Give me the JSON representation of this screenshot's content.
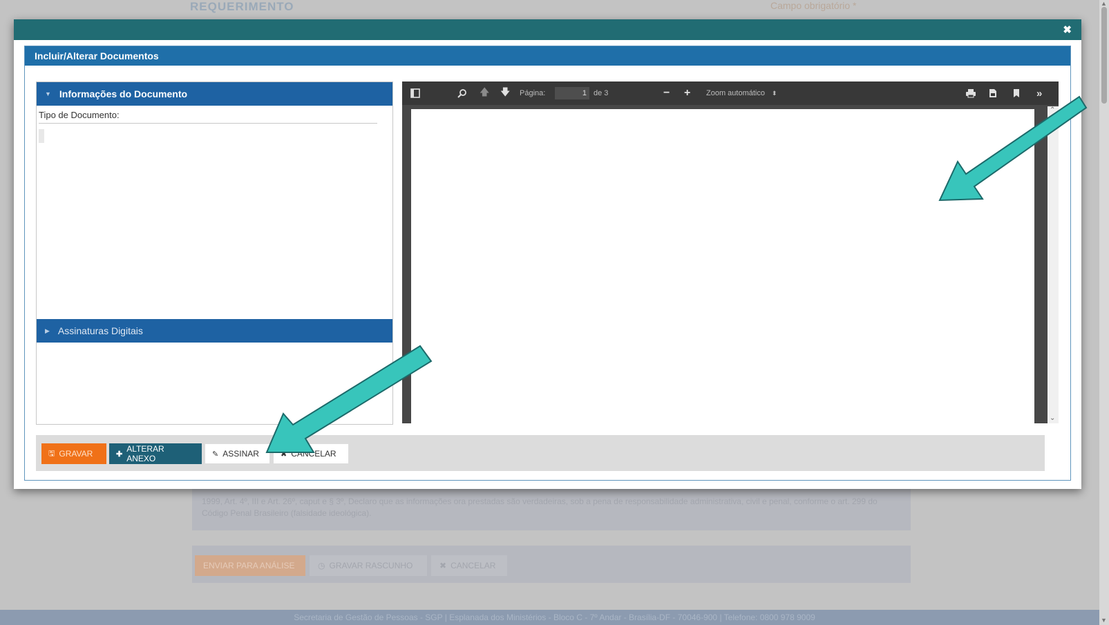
{
  "background": {
    "title": "REQUERIMENTO",
    "top_right": "Campo obrigatório *",
    "declaration_text": "1999, Art. 4º, III e Art. 26º, caput e § 3º, Declaro que as informações ora prestadas são verdadeiras, sob a pena de responsabilidade administrativa, civil e penal, conforme o art. 299 do Código Penal Brasileiro (falsidade ideológica).",
    "actions": {
      "send_label": "ENVIAR PARA ANÁLISE",
      "draft_label": "GRAVAR RASCUNHO",
      "cancel_label": "CANCELAR"
    },
    "footer": "Secretaria de Gestão de Pessoas - SGP | Esplanada dos Ministérios - Bloco C - 7º Andar - Brasília-DF - 70046-900 | Telefone: 0800 978 9009"
  },
  "modal": {
    "close_glyph": "✖",
    "title": "Incluir/Alterar Documentos",
    "info_section": {
      "title": "Informações do Documento",
      "tipo_label": "Tipo de Documento:"
    },
    "signatures_section": {
      "title": "Assinaturas Digitais"
    },
    "viewer": {
      "page_label": "Página:",
      "page_value": "1",
      "page_total": "de 3",
      "zoom_label": "Zoom automático"
    },
    "buttons": {
      "gravar": "GRAVAR",
      "alterar_anexo": "ALTERAR ANEXO",
      "assinar": "ASSINAR",
      "cancelar": "CANCELAR"
    }
  },
  "colors": {
    "modal_header": "#216c73",
    "dialog_title": "#1f6fa9",
    "section_header": "#1e62a3",
    "gravar": "#f07118",
    "alterar": "#1e6077",
    "arrow": "#38c5bb"
  },
  "icons": [
    "sidebar-toggle-icon",
    "search-icon",
    "prev-page-icon",
    "next-page-icon",
    "zoom-out-icon",
    "zoom-in-icon",
    "print-icon",
    "download-icon",
    "bookmark-icon",
    "tools-icon"
  ]
}
